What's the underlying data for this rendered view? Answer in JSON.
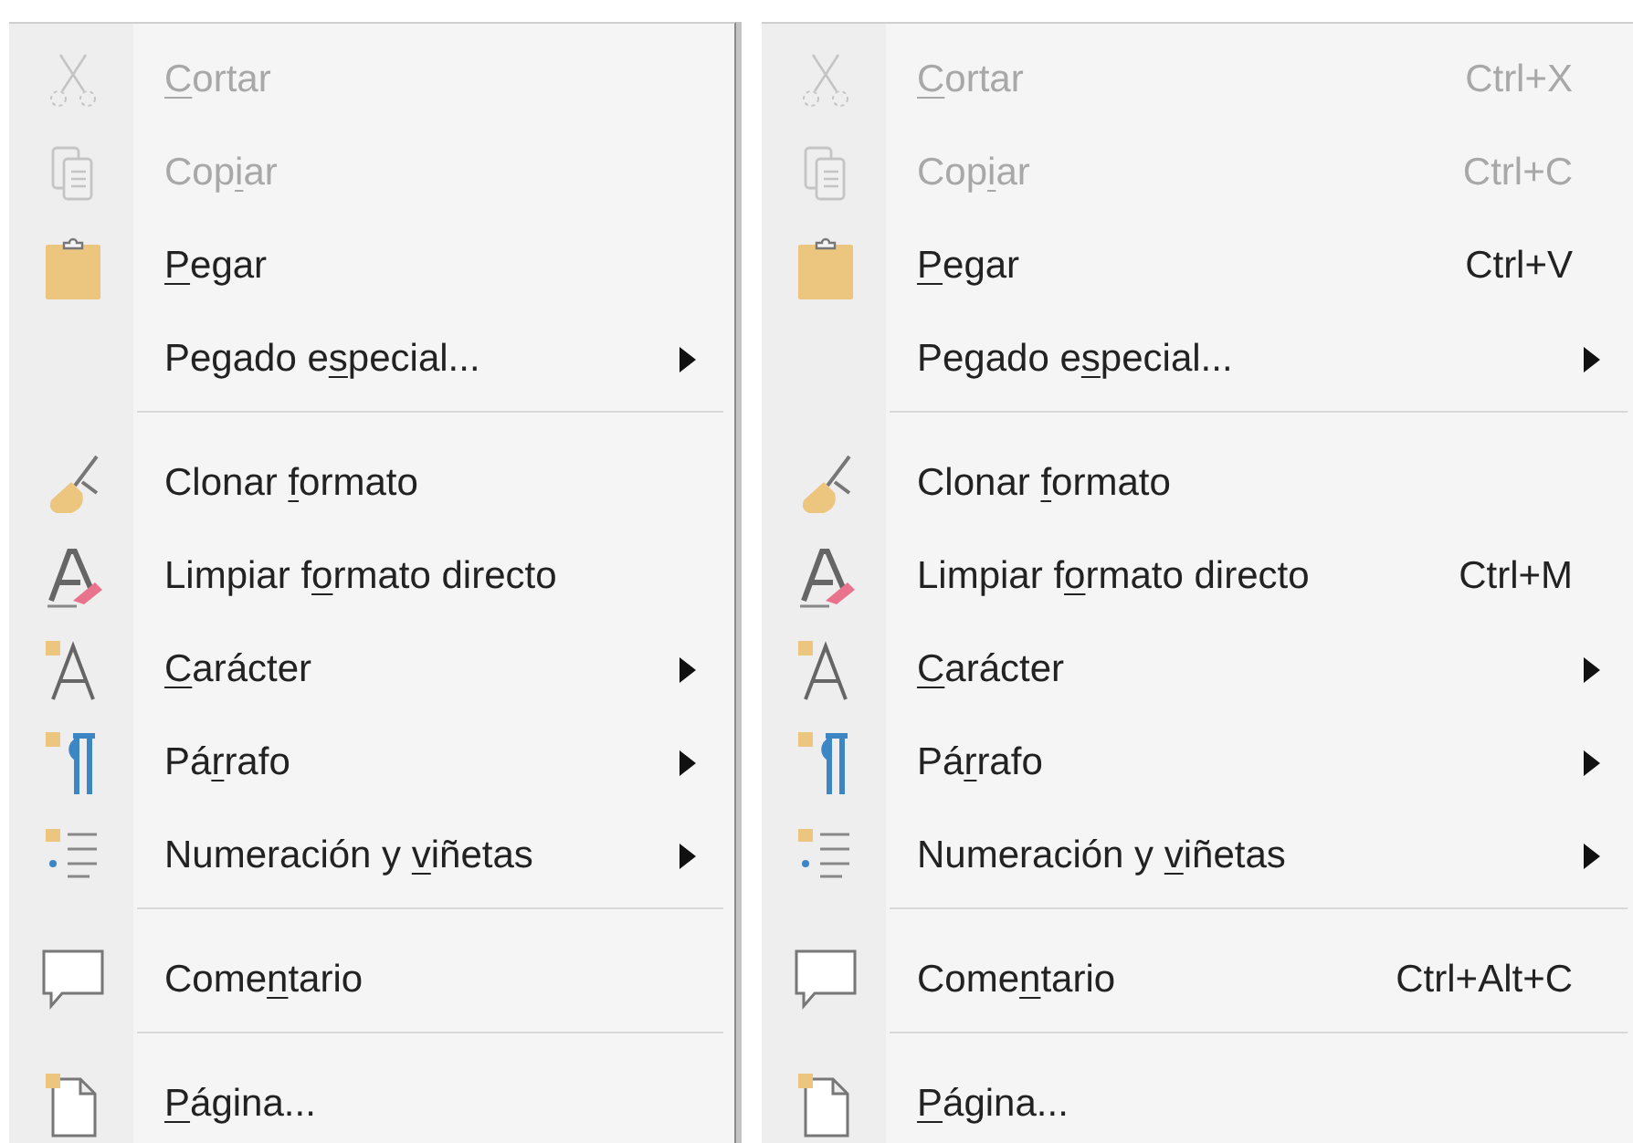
{
  "menus": [
    {
      "items": [
        {
          "kind": "item",
          "label": {
            "key": "C",
            "after": "ortar"
          },
          "disabled": true
        },
        {
          "kind": "item",
          "label": {
            "before": "Cop",
            "key": "i",
            "after": "ar"
          },
          "disabled": true
        },
        {
          "kind": "item",
          "label": {
            "key": "P",
            "after": "egar"
          },
          "disabled": false
        },
        {
          "kind": "item",
          "label": {
            "before": "Pegado e",
            "key": "s",
            "after": "pecial..."
          },
          "disabled": false,
          "submenu": true
        },
        {
          "kind": "separator"
        },
        {
          "kind": "item",
          "label": {
            "before": "Clonar ",
            "key": "f",
            "after": "ormato"
          },
          "disabled": false
        },
        {
          "kind": "item",
          "label": {
            "before": "Limpiar f",
            "key": "o",
            "after": "rmato directo"
          },
          "disabled": false
        },
        {
          "kind": "item",
          "label": {
            "key": "C",
            "after": "arácter"
          },
          "disabled": false,
          "submenu": true
        },
        {
          "kind": "item",
          "label": {
            "before": "Pá",
            "key": "r",
            "after": "rafo"
          },
          "disabled": false,
          "submenu": true
        },
        {
          "kind": "item",
          "label": {
            "before": "Numeración y ",
            "key": "v",
            "after": "iñetas"
          },
          "disabled": false,
          "submenu": true
        },
        {
          "kind": "separator"
        },
        {
          "kind": "item",
          "label": {
            "before": "Come",
            "key": "n",
            "after": "tario"
          },
          "disabled": false
        },
        {
          "kind": "separator"
        },
        {
          "kind": "item",
          "label": {
            "key": "P",
            "after": "ágina..."
          },
          "disabled": false
        }
      ]
    },
    {
      "items": [
        {
          "kind": "item",
          "label": {
            "key": "C",
            "after": "ortar"
          },
          "disabled": true,
          "shortcut": "Ctrl+X"
        },
        {
          "kind": "item",
          "label": {
            "before": "Cop",
            "key": "i",
            "after": "ar"
          },
          "disabled": true,
          "shortcut": "Ctrl+C"
        },
        {
          "kind": "item",
          "label": {
            "key": "P",
            "after": "egar"
          },
          "disabled": false,
          "shortcut": "Ctrl+V"
        },
        {
          "kind": "item",
          "label": {
            "before": "Pegado e",
            "key": "s",
            "after": "pecial..."
          },
          "disabled": false,
          "submenu": true
        },
        {
          "kind": "separator"
        },
        {
          "kind": "item",
          "label": {
            "before": "Clonar ",
            "key": "f",
            "after": "ormato"
          },
          "disabled": false
        },
        {
          "kind": "item",
          "label": {
            "before": "Limpiar f",
            "key": "o",
            "after": "rmato directo"
          },
          "disabled": false,
          "shortcut": "Ctrl+M"
        },
        {
          "kind": "item",
          "label": {
            "key": "C",
            "after": "arácter"
          },
          "disabled": false,
          "submenu": true
        },
        {
          "kind": "item",
          "label": {
            "before": "Pá",
            "key": "r",
            "after": "rafo"
          },
          "disabled": false,
          "submenu": true
        },
        {
          "kind": "item",
          "label": {
            "before": "Numeración y ",
            "key": "v",
            "after": "iñetas"
          },
          "disabled": false,
          "submenu": true
        },
        {
          "kind": "separator"
        },
        {
          "kind": "item",
          "label": {
            "before": "Come",
            "key": "n",
            "after": "tario"
          },
          "disabled": false,
          "shortcut": "Ctrl+Alt+C"
        },
        {
          "kind": "separator"
        },
        {
          "kind": "item",
          "label": {
            "key": "P",
            "after": "ágina..."
          },
          "disabled": false
        }
      ]
    }
  ]
}
